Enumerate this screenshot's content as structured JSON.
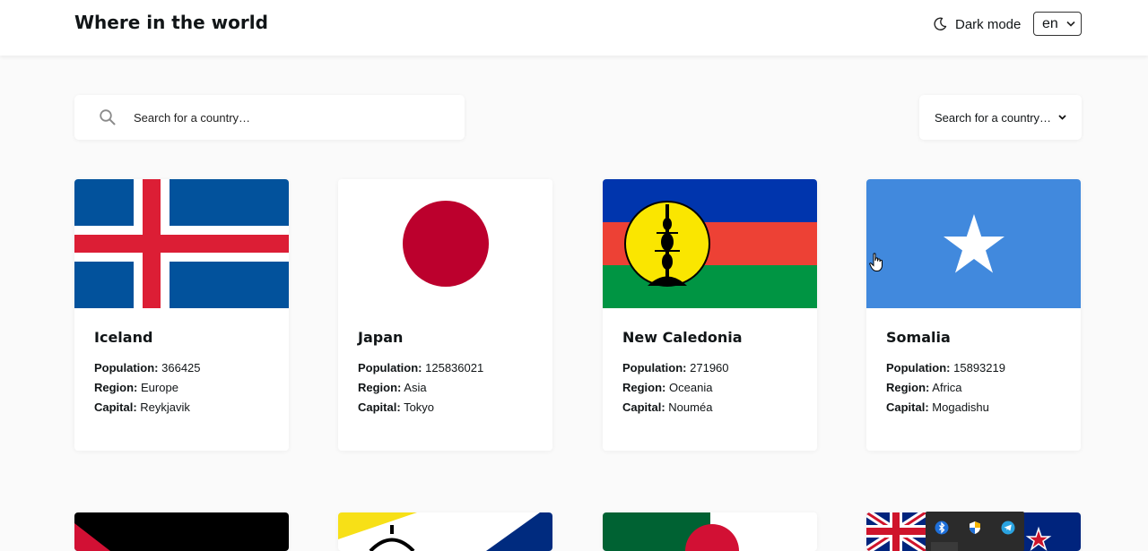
{
  "header": {
    "title": "Where in the world",
    "dark_mode_label": "Dark mode",
    "language": "en"
  },
  "search": {
    "placeholder": "Search for a country…",
    "value": ""
  },
  "filter": {
    "label": "Search for a country…"
  },
  "labels": {
    "population": "Population:",
    "region": "Region:",
    "capital": "Capital:"
  },
  "countries": [
    {
      "name": "Iceland",
      "population": "366425",
      "region": "Europe",
      "capital": "Reykjavik"
    },
    {
      "name": "Japan",
      "population": "125836021",
      "region": "Asia",
      "capital": "Tokyo"
    },
    {
      "name": "New Caledonia",
      "population": "271960",
      "region": "Oceania",
      "capital": "Nouméa"
    },
    {
      "name": "Somalia",
      "population": "15893219",
      "region": "Africa",
      "capital": "Mogadishu"
    }
  ],
  "colors": {
    "background": "#fafafa",
    "card": "#ffffff",
    "text": "#111517"
  }
}
